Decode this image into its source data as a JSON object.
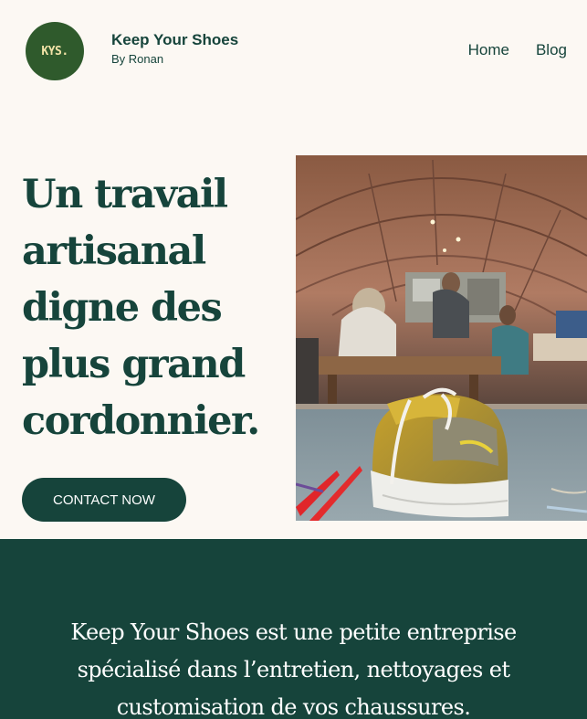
{
  "header": {
    "logo_text": "KYS.",
    "brand_title": "Keep Your Shoes",
    "brand_subtitle": "By Ronan",
    "nav": [
      {
        "label": "Home"
      },
      {
        "label": "Blog"
      }
    ]
  },
  "hero": {
    "title": "Un travail artisanal digne des plus grand cordonnier.",
    "cta_label": "CONTACT NOW"
  },
  "about": {
    "text": "Keep Your Shoes est une petite entreprise spécialisé dans l’entretien, nettoyages et customisation de vos chaussures."
  },
  "colors": {
    "primary": "#16443b",
    "background": "#fcf8f3",
    "logo_bg": "#2f5a2c",
    "logo_text": "#f3e4a8"
  }
}
